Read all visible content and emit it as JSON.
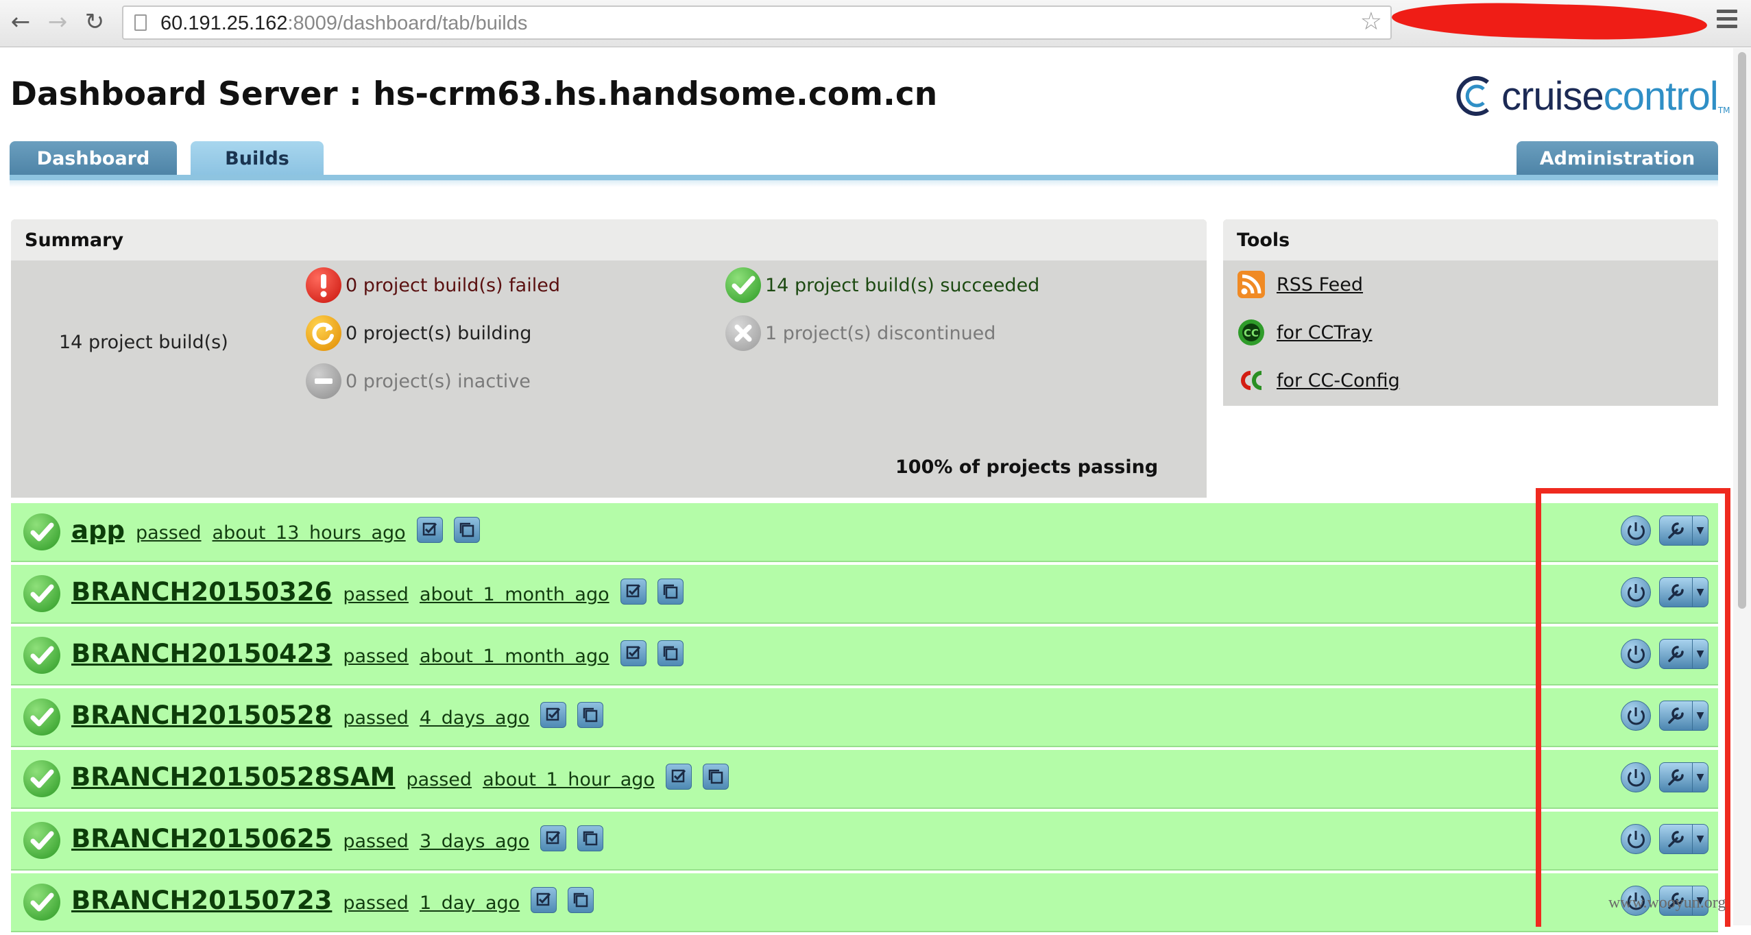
{
  "browser": {
    "url_host": "60.191.25.162",
    "url_rest": ":8009/dashboard/tab/builds"
  },
  "header": {
    "title": "Dashboard Server : hs-crm63.hs.handsome.com.cn",
    "logo_part1": "cruise",
    "logo_part2": "control",
    "logo_tm": "TM"
  },
  "tabs": [
    {
      "label": "Dashboard",
      "active": false
    },
    {
      "label": "Builds",
      "active": true
    },
    {
      "label": "Administration",
      "active": false
    }
  ],
  "summary": {
    "heading": "Summary",
    "total": "14 project build(s)",
    "failed": "0 project build(s) failed",
    "succeeded": "14 project build(s) succeeded",
    "building": "0 project(s) building",
    "discontinued": "1 project(s) discontinued",
    "inactive": "0 project(s) inactive",
    "passing": "100% of projects passing"
  },
  "tools": {
    "heading": "Tools",
    "rss": "RSS Feed",
    "cctray": "for CCTray",
    "ccconfig": "for CC-Config"
  },
  "builds": [
    {
      "name": "app",
      "status": "passed",
      "time": "about 13 hours ago"
    },
    {
      "name": "BRANCH20150326",
      "status": "passed",
      "time": "about 1 month ago"
    },
    {
      "name": "BRANCH20150423",
      "status": "passed",
      "time": "about 1 month ago"
    },
    {
      "name": "BRANCH20150528",
      "status": "passed",
      "time": "4 days ago"
    },
    {
      "name": "BRANCH20150528SAM",
      "status": "passed",
      "time": "about 1 hour ago"
    },
    {
      "name": "BRANCH20150625",
      "status": "passed",
      "time": "3 days ago"
    },
    {
      "name": "BRANCH20150723",
      "status": "passed",
      "time": "1 day ago"
    }
  ],
  "watermark": "www.wooyun.org",
  "colors": {
    "row_passed": "#b4fca8",
    "tab": "#5a8fb2",
    "tab_active": "#9ccde8",
    "highlight": "#ef2a1f"
  }
}
